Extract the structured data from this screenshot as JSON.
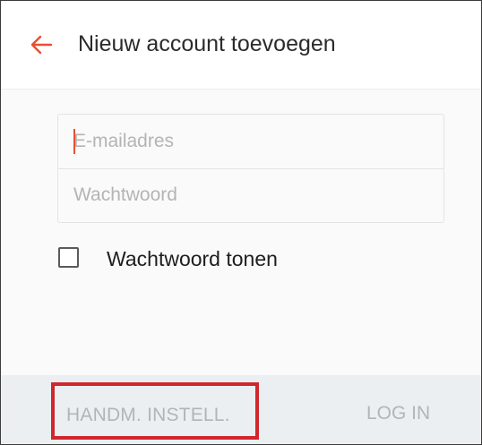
{
  "header": {
    "title": "Nieuw account toevoegen",
    "back_icon": "arrow-left-icon"
  },
  "form": {
    "email": {
      "placeholder": "E-mailadres",
      "value": ""
    },
    "password": {
      "placeholder": "Wachtwoord",
      "value": ""
    },
    "show_password": {
      "label": "Wachtwoord tonen",
      "checked": false
    }
  },
  "footer": {
    "manual_setup_label": "HANDM. INSTELL.",
    "login_label": "LOG IN"
  },
  "colors": {
    "accent": "#e8502e",
    "highlight_border": "#d0262d",
    "disabled_text": "#b2b5b8",
    "bottom_bar": "#eceff1"
  }
}
